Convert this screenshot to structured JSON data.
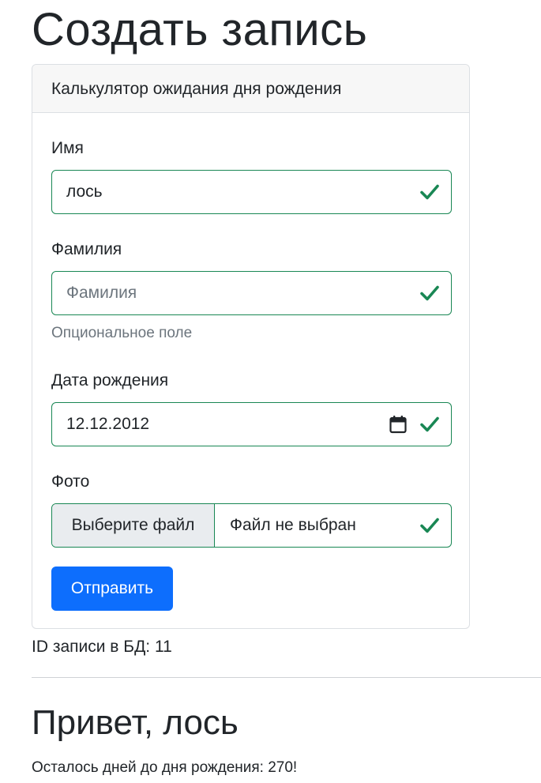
{
  "page": {
    "title": "Создать запись"
  },
  "form": {
    "header": "Калькулятор ожидания дня рождения",
    "first_name": {
      "label": "Имя",
      "value": "лось"
    },
    "last_name": {
      "label": "Фамилия",
      "placeholder": "Фамилия",
      "help": "Опциональное поле"
    },
    "birth_date": {
      "label": "Дата рождения",
      "value": "12.12.2012"
    },
    "photo": {
      "label": "Фото",
      "button_label": "Выберите файл",
      "status": "Файл не выбран"
    },
    "submit_label": "Отправить"
  },
  "result": {
    "record_id_text": "ID записи в БД: 11",
    "greeting": "Привет, лось",
    "days_left_text": "Осталось дней до дня рождения: 270!"
  },
  "icons": {
    "valid": "check-icon",
    "date_picker": "calendar-icon"
  },
  "colors": {
    "primary": "#0d6efd",
    "valid": "#198754",
    "muted": "#6c757d",
    "text": "#212529"
  }
}
